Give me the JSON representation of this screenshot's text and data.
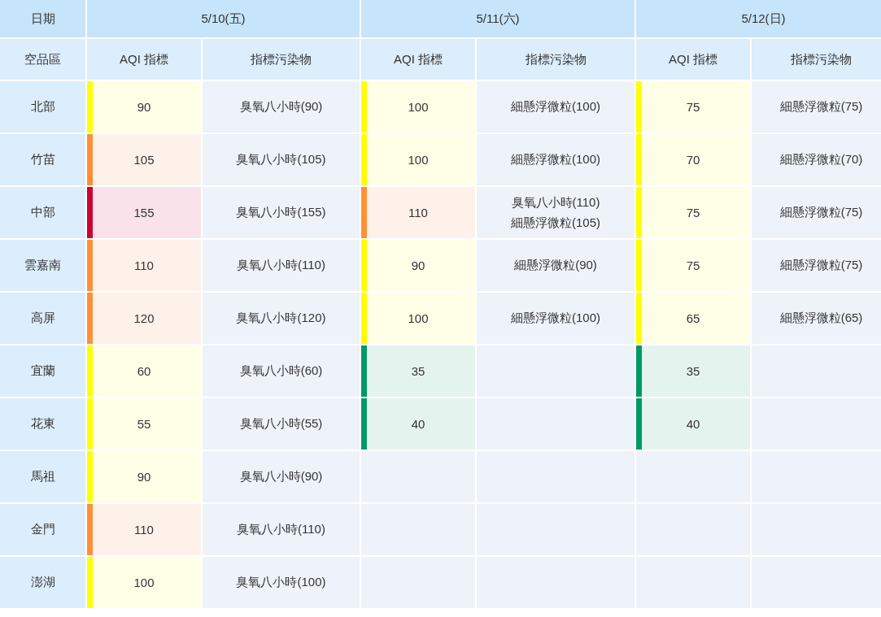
{
  "table": {
    "corner_label": "日期",
    "region_label": "空品區",
    "dates": [
      {
        "label": "5/10(五)",
        "aqi_label": "AQI 指標",
        "pollutant_label": "指標污染物"
      },
      {
        "label": "5/11(六)",
        "aqi_label": "AQI 指標",
        "pollutant_label": "指標污染物"
      },
      {
        "label": "5/12(日)",
        "aqi_label": "AQI 指標",
        "pollutant_label": "指標污染物"
      }
    ],
    "rows": [
      {
        "region": "北部",
        "days": [
          {
            "aqi": "90",
            "kind": "moderate",
            "pollutants": [
              "臭氧八小時(90)"
            ]
          },
          {
            "aqi": "100",
            "kind": "moderate",
            "pollutants": [
              "細懸浮微粒(100)"
            ]
          },
          {
            "aqi": "75",
            "kind": "moderate",
            "pollutants": [
              "細懸浮微粒(75)"
            ]
          }
        ]
      },
      {
        "region": "竹苗",
        "days": [
          {
            "aqi": "105",
            "kind": "sensitive",
            "pollutants": [
              "臭氧八小時(105)"
            ]
          },
          {
            "aqi": "100",
            "kind": "moderate",
            "pollutants": [
              "細懸浮微粒(100)"
            ]
          },
          {
            "aqi": "70",
            "kind": "moderate",
            "pollutants": [
              "細懸浮微粒(70)"
            ]
          }
        ]
      },
      {
        "region": "中部",
        "days": [
          {
            "aqi": "155",
            "kind": "unhealthy",
            "pollutants": [
              "臭氧八小時(155)"
            ]
          },
          {
            "aqi": "110",
            "kind": "sensitive",
            "pollutants": [
              "臭氧八小時(110)",
              "細懸浮微粒(105)"
            ]
          },
          {
            "aqi": "75",
            "kind": "moderate",
            "pollutants": [
              "細懸浮微粒(75)"
            ]
          }
        ]
      },
      {
        "region": "雲嘉南",
        "days": [
          {
            "aqi": "110",
            "kind": "sensitive",
            "pollutants": [
              "臭氧八小時(110)"
            ]
          },
          {
            "aqi": "90",
            "kind": "moderate",
            "pollutants": [
              "細懸浮微粒(90)"
            ]
          },
          {
            "aqi": "75",
            "kind": "moderate",
            "pollutants": [
              "細懸浮微粒(75)"
            ]
          }
        ]
      },
      {
        "region": "高屏",
        "days": [
          {
            "aqi": "120",
            "kind": "sensitive",
            "pollutants": [
              "臭氧八小時(120)"
            ]
          },
          {
            "aqi": "100",
            "kind": "moderate",
            "pollutants": [
              "細懸浮微粒(100)"
            ]
          },
          {
            "aqi": "65",
            "kind": "moderate",
            "pollutants": [
              "細懸浮微粒(65)"
            ]
          }
        ]
      },
      {
        "region": "宜蘭",
        "days": [
          {
            "aqi": "60",
            "kind": "moderate",
            "pollutants": [
              "臭氧八小時(60)"
            ]
          },
          {
            "aqi": "35",
            "kind": "good"
          },
          {
            "aqi": "35",
            "kind": "good"
          }
        ]
      },
      {
        "region": "花東",
        "days": [
          {
            "aqi": "55",
            "kind": "moderate",
            "pollutants": [
              "臭氧八小時(55)"
            ]
          },
          {
            "aqi": "40",
            "kind": "good"
          },
          {
            "aqi": "40",
            "kind": "good"
          }
        ]
      },
      {
        "region": "馬祖",
        "days": [
          {
            "aqi": "90",
            "kind": "moderate",
            "pollutants": [
              "臭氧八小時(90)"
            ]
          }
        ]
      },
      {
        "region": "金門",
        "days": [
          {
            "aqi": "110",
            "kind": "sensitive",
            "pollutants": [
              "臭氧八小時(110)"
            ]
          }
        ]
      },
      {
        "region": "澎湖",
        "days": [
          {
            "aqi": "100",
            "kind": "moderate",
            "pollutants": [
              "臭氧八小時(100)"
            ]
          }
        ]
      }
    ]
  }
}
